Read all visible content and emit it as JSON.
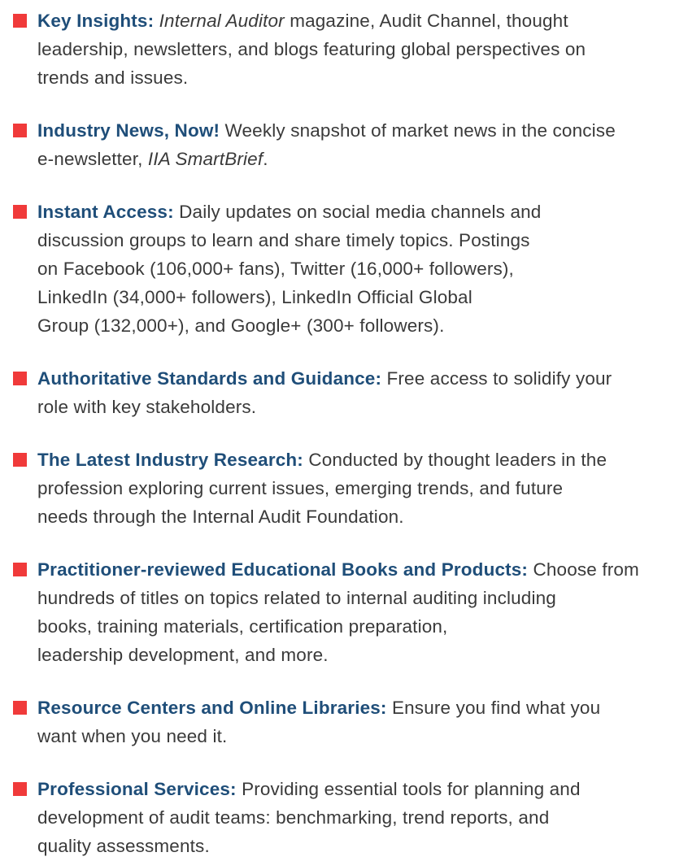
{
  "colors": {
    "bullet": "#f03a3a",
    "title": "#1f4e79",
    "text": "#3a3a3a"
  },
  "items": [
    {
      "title": "Key Insights:",
      "lines": [
        [
          {
            "t": " ",
            "i": false
          },
          {
            "t": "Internal Auditor",
            "i": true
          },
          {
            "t": " magazine, Audit Channel, thought",
            "i": false
          }
        ],
        [
          {
            "t": "leadership, newsletters, and blogs featuring global perspectives on",
            "i": false
          }
        ],
        [
          {
            "t": "trends and issues.",
            "i": false
          }
        ]
      ]
    },
    {
      "title": "Industry News, Now!",
      "lines": [
        [
          {
            "t": " Weekly snapshot of market news in the concise",
            "i": false
          }
        ],
        [
          {
            "t": "e-newsletter, ",
            "i": false
          },
          {
            "t": "IIA SmartBrief",
            "i": true
          },
          {
            "t": ".",
            "i": false
          }
        ]
      ]
    },
    {
      "title": "Instant Access:",
      "lines": [
        [
          {
            "t": " Daily updates on social media channels and",
            "i": false
          }
        ],
        [
          {
            "t": "discussion groups to learn and share timely topics. Postings",
            "i": false
          }
        ],
        [
          {
            "t": "on Facebook (106,000+ fans), Twitter (16,000+ followers),",
            "i": false
          }
        ],
        [
          {
            "t": "LinkedIn (34,000+ followers), LinkedIn Official Global",
            "i": false
          }
        ],
        [
          {
            "t": "Group (132,000+), and Google+ (300+ followers).",
            "i": false
          }
        ]
      ]
    },
    {
      "title": "Authoritative Standards and Guidance:",
      "lines": [
        [
          {
            "t": " Free access to solidify your",
            "i": false
          }
        ],
        [
          {
            "t": "role with key stakeholders.",
            "i": false
          }
        ]
      ]
    },
    {
      "title": "The Latest Industry Research:",
      "lines": [
        [
          {
            "t": " Conducted by thought leaders in the",
            "i": false
          }
        ],
        [
          {
            "t": "profession exploring current issues, emerging trends, and future",
            "i": false
          }
        ],
        [
          {
            "t": "needs through the Internal Audit Foundation.",
            "i": false
          }
        ]
      ]
    },
    {
      "title": "Practitioner-reviewed Educational Books and Products:",
      "lines": [
        [
          {
            "t": " Choose from",
            "i": false
          }
        ],
        [
          {
            "t": "hundreds of titles on topics related to internal auditing including",
            "i": false
          }
        ],
        [
          {
            "t": "books, training materials, certification preparation,",
            "i": false
          }
        ],
        [
          {
            "t": "leadership development, and more.",
            "i": false
          }
        ]
      ]
    },
    {
      "title": "Resource Centers and Online Libraries:",
      "lines": [
        [
          {
            "t": " Ensure you find what you",
            "i": false
          }
        ],
        [
          {
            "t": "want when you need it.",
            "i": false
          }
        ]
      ]
    },
    {
      "title": "Professional Services:",
      "lines": [
        [
          {
            "t": " Providing essential tools for planning and",
            "i": false
          }
        ],
        [
          {
            "t": "development of audit teams: benchmarking, trend reports, and",
            "i": false
          }
        ],
        [
          {
            "t": "quality assessments.",
            "i": false
          }
        ]
      ]
    }
  ]
}
